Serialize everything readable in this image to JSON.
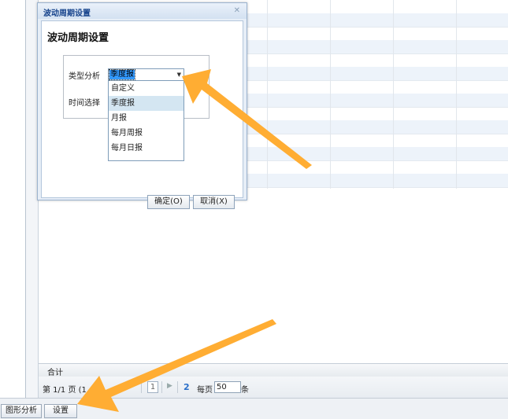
{
  "dialog": {
    "title": "波动周期设置",
    "heading": "波动周期设置",
    "type_label": "类型分析",
    "time_label": "时间选择",
    "selected_value": "季度报",
    "options": [
      "自定义",
      "季度报",
      "月报",
      "每月周报",
      "每月日报"
    ],
    "selected_index": 1,
    "ok_label": "确定(O)",
    "cancel_label": "取消(X)"
  },
  "grid": {
    "total_label": "合计"
  },
  "pager": {
    "page_text": "第 1/1 页 (1",
    "current_page": "1",
    "per_page_label": "每页",
    "page_size": "50",
    "unit": "条"
  },
  "bottom": {
    "chart_analysis_label": "图形分析",
    "settings_label": "设置"
  },
  "colors": {
    "arrow": "#ffad33",
    "title_text": "#15428b",
    "selection": "#3399ff",
    "dropdown_highlight": "#d4e6f2"
  }
}
